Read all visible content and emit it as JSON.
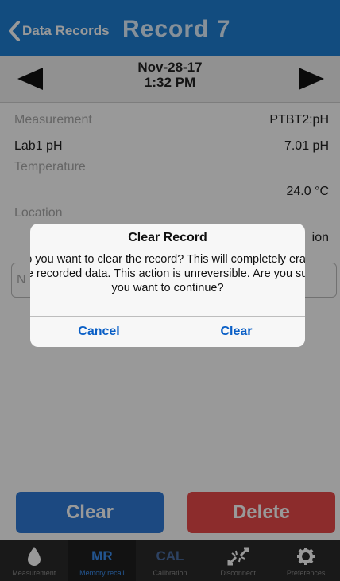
{
  "nav": {
    "back_label": "Data Records",
    "title": "Record 7"
  },
  "record": {
    "date": "Nov-28-17",
    "time": "1:32 PM",
    "measurement_label": "Measurement",
    "measurement_value": "PTBT2:pH",
    "reading_label": "Lab1 pH",
    "reading_value": "7.01 pH",
    "temperature_label": "Temperature",
    "temperature_value": "24.0 °C",
    "location_label": "Location",
    "location_value": "ion",
    "notes_placeholder": "N"
  },
  "actions": {
    "clear_label": "Clear",
    "delete_label": "Delete"
  },
  "tabs": [
    {
      "icon": "droplet-icon",
      "label": "Measurement"
    },
    {
      "icon": "MR",
      "label": "Memory recall"
    },
    {
      "icon": "CAL",
      "label": "Calibration"
    },
    {
      "icon": "disconnect-icon",
      "label": "Disconnect"
    },
    {
      "icon": "gear-icon",
      "label": "Preferences"
    }
  ],
  "dialog": {
    "title": "Clear Record",
    "message": "Do you want to clear the record? This will completely erase the recorded data. This action is unreversible. Are you sure you want to continue?",
    "cancel_label": "Cancel",
    "confirm_label": "Clear"
  },
  "colors": {
    "nav_bg": "#1f7fd4",
    "clear_button": "#2f7bd8",
    "delete_button": "#e94a4a",
    "tabbar_bg": "#2b2b2b",
    "dialog_button_text": "#0a5fc6"
  }
}
